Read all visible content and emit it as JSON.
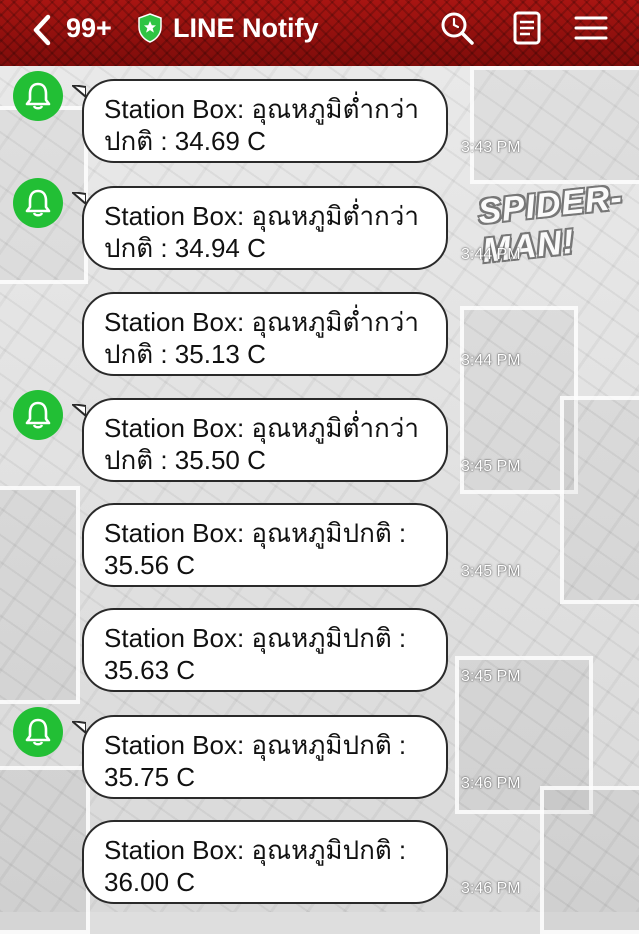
{
  "header": {
    "unread_count": "99+",
    "title": "LINE Notify"
  },
  "colors": {
    "header": "#8f100d",
    "avatar": "#22bf35",
    "bubble": "#ffffff"
  },
  "background_text": "SPIDER-MAN!",
  "messages": [
    {
      "line1": "Station Box: อุณหภูมิต่ำกว่า",
      "line2": "ปกติ : 34.69 C",
      "time": "3:43 PM",
      "avatar": true
    },
    {
      "line1": "Station Box: อุณหภูมิต่ำกว่า",
      "line2": "ปกติ : 34.94 C",
      "time": "3:44 PM",
      "avatar": true
    },
    {
      "line1": "Station Box: อุณหภูมิต่ำกว่า",
      "line2": "ปกติ : 35.13 C",
      "time": "3:44 PM",
      "avatar": false
    },
    {
      "line1": "Station Box: อุณหภูมิต่ำกว่า",
      "line2": "ปกติ : 35.50 C",
      "time": "3:45 PM",
      "avatar": true
    },
    {
      "line1": "Station Box: อุณหภูมิปกติ :",
      "line2": "35.56 C",
      "time": "3:45 PM",
      "avatar": false
    },
    {
      "line1": "Station Box: อุณหภูมิปกติ :",
      "line2": "35.63 C",
      "time": "3:45 PM",
      "avatar": false
    },
    {
      "line1": "Station Box: อุณหภูมิปกติ :",
      "line2": "35.75 C",
      "time": "3:46 PM",
      "avatar": true
    },
    {
      "line1": "Station Box: อุณหภูมิปกติ :",
      "line2": "36.00 C",
      "time": "3:46 PM",
      "avatar": false
    }
  ]
}
